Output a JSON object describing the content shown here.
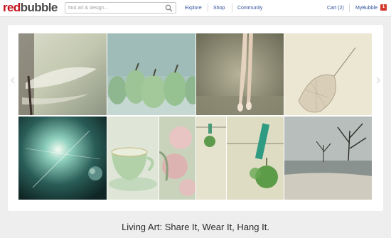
{
  "header": {
    "logo": {
      "part1": "red",
      "part2": "bubble"
    },
    "search": {
      "placeholder": "find art & design..."
    },
    "nav": [
      "Explore",
      "Shop",
      "Community"
    ],
    "cart_label": "Cart (2)",
    "account_label": "MyBubble",
    "notification_count": "1"
  },
  "gallery": {
    "tiles": [
      {
        "subject": "dragonfly wing close-up"
      },
      {
        "subject": "row of green pears"
      },
      {
        "subject": "ballerina legs in pointe shoes"
      },
      {
        "subject": "dried physalis lantern"
      },
      {
        "subject": "galaxy with planet"
      },
      {
        "subject": "green teacup and saucer"
      },
      {
        "subject": "pink roses"
      },
      {
        "subject": "green apple hanging on clothesline"
      },
      {
        "subject": "green apple hanging on peg"
      },
      {
        "subject": "bare trees on beach"
      }
    ]
  },
  "tagline": "Living Art: Share It, Wear It, Hang It.",
  "colors": {
    "brand_red": "#c2121b",
    "link_blue": "#2d4f9a",
    "badge_red": "#d33a2e"
  }
}
